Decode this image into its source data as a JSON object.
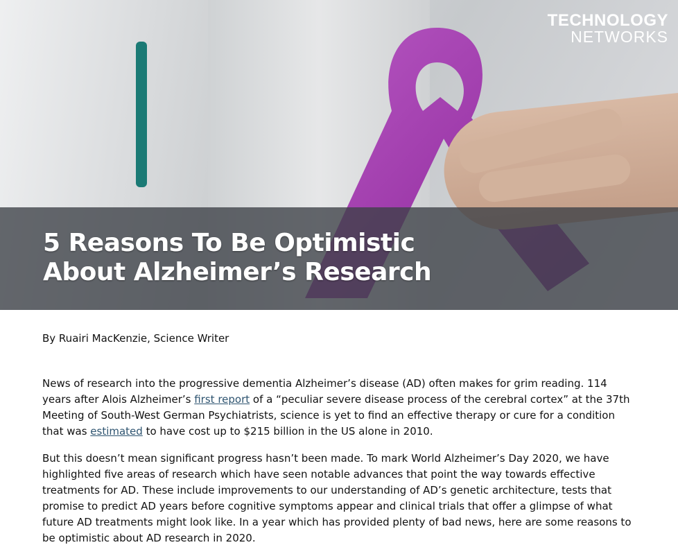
{
  "header": {
    "logo_line1": "TECHNOLOGY",
    "logo_line2": "NETWORKS",
    "title_line1": "5 Reasons To Be Optimistic",
    "title_line2": "About Alzheimer’s Research"
  },
  "article": {
    "byline": "By Ruairi MacKenzie, Science Writer",
    "p1": {
      "t1": "News of research into the progressive dementia Alzheimer’s disease (AD) often makes for grim reading. 114 years after Alois Alzheimer’s ",
      "link1": "first report",
      "t2": " of a “peculiar severe disease process of the cerebral cortex” at the 37th Meeting of South-West German Psychiatrists, science is yet to find an effective therapy or cure for a condition that was ",
      "link2": "estimated",
      "t3": " to have cost up to $215 billion in the US alone in 2010."
    },
    "p2": "But this doesn’t mean significant progress hasn’t been made. To mark World Alzheimer’s Day 2020, we have highlighted five areas of research which have seen notable advances that point the way towards effective treatments for AD. These include improvements to our understanding of AD’s genetic architecture, tests that promise to predict AD years before cognitive symptoms appear and clinical trials that offer a glimpse of what future AD treatments might look like. In a year which has provided plenty of bad news, here are some reasons to be optimistic about AD research in 2020."
  },
  "colors": {
    "ribbon": "#9b2fa8",
    "link": "#2e5470",
    "title_band": "#3c4046"
  }
}
